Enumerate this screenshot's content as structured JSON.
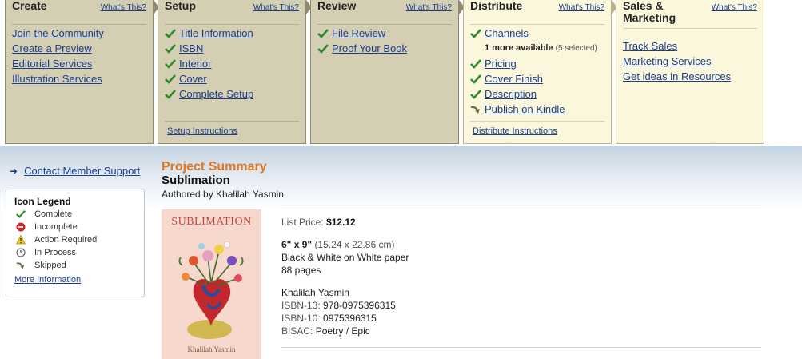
{
  "nav": {
    "create": {
      "title": "Create",
      "whats_this": "What's This?",
      "items": [
        "Join the Community",
        "Create a Preview",
        "Editorial Services",
        "Illustration Services"
      ]
    },
    "setup": {
      "title": "Setup",
      "whats_this": "What's This?",
      "items": [
        "Title Information",
        "ISBN",
        "Interior",
        "Cover",
        "Complete Setup"
      ],
      "instructions": "Setup Instructions"
    },
    "review": {
      "title": "Review",
      "whats_this": "What's This?",
      "items": [
        "File Review",
        "Proof Your Book"
      ]
    },
    "distribute": {
      "title": "Distribute",
      "whats_this": "What's This?",
      "channels": "Channels",
      "more_available": "1 more available",
      "selected": "(5 selected)",
      "pricing": "Pricing",
      "cover_finish": "Cover Finish",
      "description": "Description",
      "publish_kindle": "Publish on Kindle",
      "instructions": "Distribute Instructions"
    },
    "sales": {
      "title": "Sales & Marketing",
      "whats_this": "What's This?",
      "items": [
        "Track Sales",
        "Marketing Services",
        "Get ideas in Resources"
      ]
    }
  },
  "sidebar": {
    "support_link": "Contact Member Support",
    "legend": {
      "title": "Icon Legend",
      "items": [
        {
          "label": "Complete",
          "icon": "check-icon"
        },
        {
          "label": "Incomplete",
          "icon": "minus-circle-icon"
        },
        {
          "label": "Action Required",
          "icon": "warning-icon"
        },
        {
          "label": "In Process",
          "icon": "clock-icon"
        },
        {
          "label": "Skipped",
          "icon": "skip-arrow-icon"
        }
      ],
      "more": "More Information"
    }
  },
  "project": {
    "label": "Project Summary",
    "title": "Sublimation",
    "author_line": "Authored by Khalilah Yasmin",
    "cover_title": "SUBLIMATION",
    "cover_author": "Khalilah Yasmin",
    "list_price_label": "List Price:",
    "list_price": "$12.12",
    "trim": "6\" x 9\"",
    "trim_cm": "(15.24 x 22.86 cm)",
    "paper": "Black & White on White paper",
    "pages": "88 pages",
    "author": "Khalilah Yasmin",
    "isbn13_label": "ISBN-13:",
    "isbn13": "978-0975396315",
    "isbn10_label": "ISBN-10:",
    "isbn10": "0975396315",
    "bisac_label": "BISAC:",
    "bisac": "Poetry / Epic"
  },
  "colors": {
    "panel_bg": "#d4cfb3",
    "panel_active_bg": "#fbf7dc",
    "link": "#1a3f8f",
    "accent_orange": "#e2761f",
    "check_green": "#2f8a2a"
  }
}
